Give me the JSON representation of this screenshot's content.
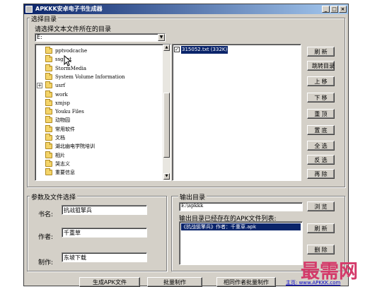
{
  "window": {
    "title": "APKKK安卓电子书生成器",
    "controls": [
      "_",
      "□",
      "×"
    ]
  },
  "directory": {
    "group_label": "选择目录",
    "prompt": "请选择文本文件所在的目录",
    "drive": "E:",
    "tree": [
      {
        "label": "pptvodcache",
        "expandable": false
      },
      {
        "label": "ssg.txt",
        "expandable": false
      },
      {
        "label": "StormMedia",
        "expandable": false
      },
      {
        "label": "System Volume Information",
        "expandable": false
      },
      {
        "label": "usrf",
        "expandable": true
      },
      {
        "label": "work",
        "expandable": false
      },
      {
        "label": "xmjsp",
        "expandable": false
      },
      {
        "label": "Youku Files",
        "expandable": false
      },
      {
        "label": "动物园",
        "expandable": false
      },
      {
        "label": "常用软件",
        "expandable": false
      },
      {
        "label": "文档",
        "expandable": false
      },
      {
        "label": "湖北幽电学院培训",
        "expandable": false
      },
      {
        "label": "相片",
        "expandable": false
      },
      {
        "label": "哭志义",
        "expandable": false
      },
      {
        "label": "重要信息",
        "expandable": false
      }
    ],
    "files": [
      {
        "label": "315052.txt (332K)",
        "checked": true
      }
    ],
    "buttons": [
      "刷 新",
      "跳转目录",
      "上 移",
      "下 移",
      "重 顶",
      "置 底",
      "全 选",
      "反 选",
      "再 除"
    ]
  },
  "params": {
    "group_label": "参数及文件选择",
    "fields": [
      {
        "label": "书名:",
        "value": "抗战狙擎兵"
      },
      {
        "label": "作者:",
        "value": "千重草"
      },
      {
        "label": "制作:",
        "value": "东坡下载"
      }
    ]
  },
  "output": {
    "group_label": "输出目录",
    "path": "E:\\apkkk",
    "browse": "浏 览",
    "existing_label": "输出目录已经存在的APK文件列表:",
    "apk_list": [
      "《抗战狙擎兵》作者：千重草.apk"
    ],
    "refresh": "刷 新",
    "delete": "删 除"
  },
  "bottom": {
    "buttons": [
      "生成APK文件",
      "批量制作",
      "相同作者批量制作"
    ],
    "homepage": "主页: www.APKKK.com"
  },
  "watermark": "最需网",
  "colors": {
    "face": "#d4d0c8",
    "title_start": "#0a246a",
    "title_end": "#a6caf0",
    "select": "#0a246a",
    "watermark": "#d43a6a",
    "link": "#0000cc"
  }
}
